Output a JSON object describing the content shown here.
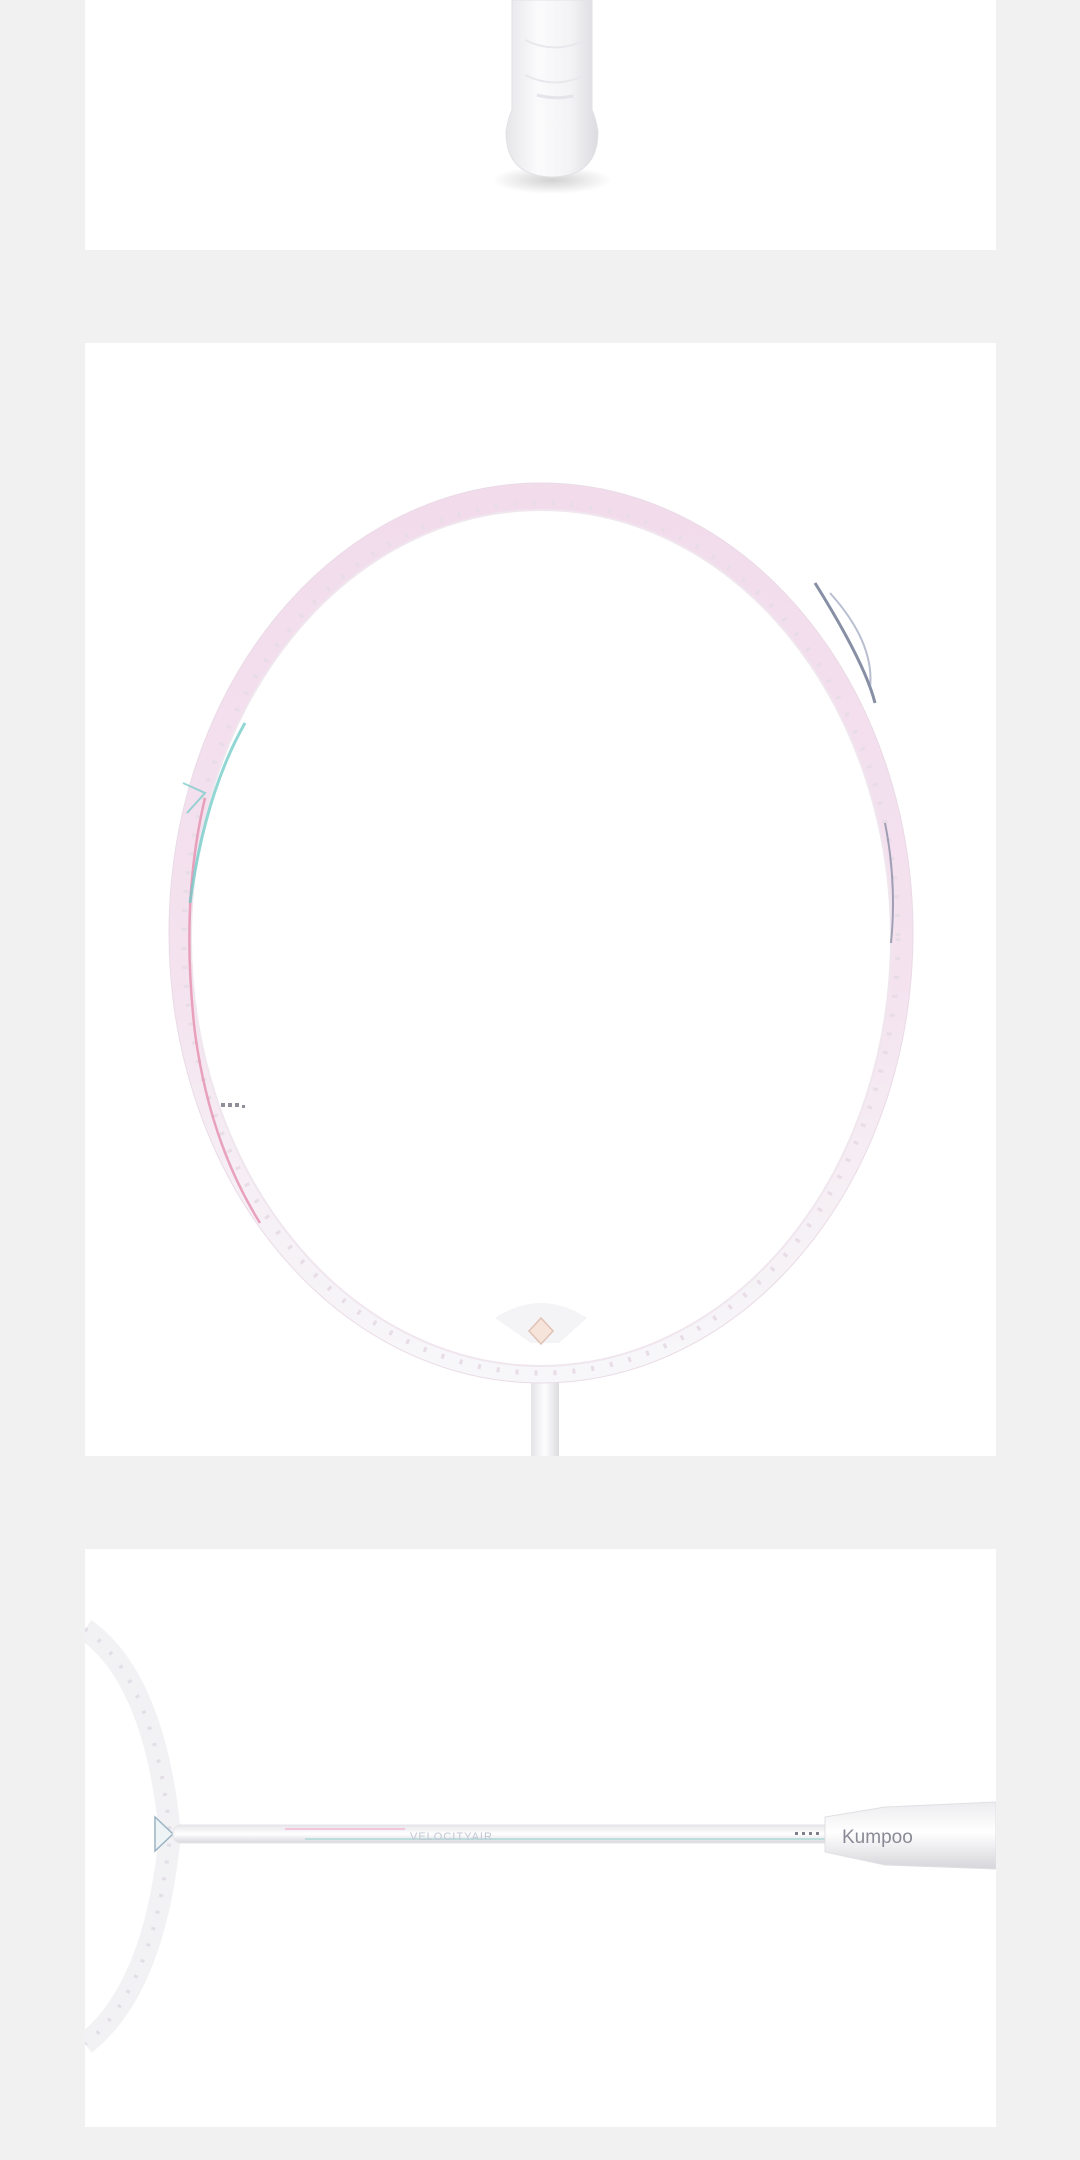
{
  "page": {
    "background": "#f1f1f1",
    "panel_background": "#ffffff"
  },
  "colors": {
    "frame_pink": "#f2dcec",
    "frame_white": "#f7f7f9",
    "accent_teal": "#6fc9c6",
    "accent_rose": "#e58fae",
    "accent_navy": "#5d6a86"
  },
  "images": [
    {
      "id": "racket-grip",
      "icon": "racket-grip-image"
    },
    {
      "id": "racket-head",
      "icon": "racket-head-image"
    },
    {
      "id": "racket-shaft",
      "icon": "racket-shaft-image"
    }
  ],
  "shaft_label": "VELOCITYAIR",
  "handle_logo": "Kumpoo"
}
